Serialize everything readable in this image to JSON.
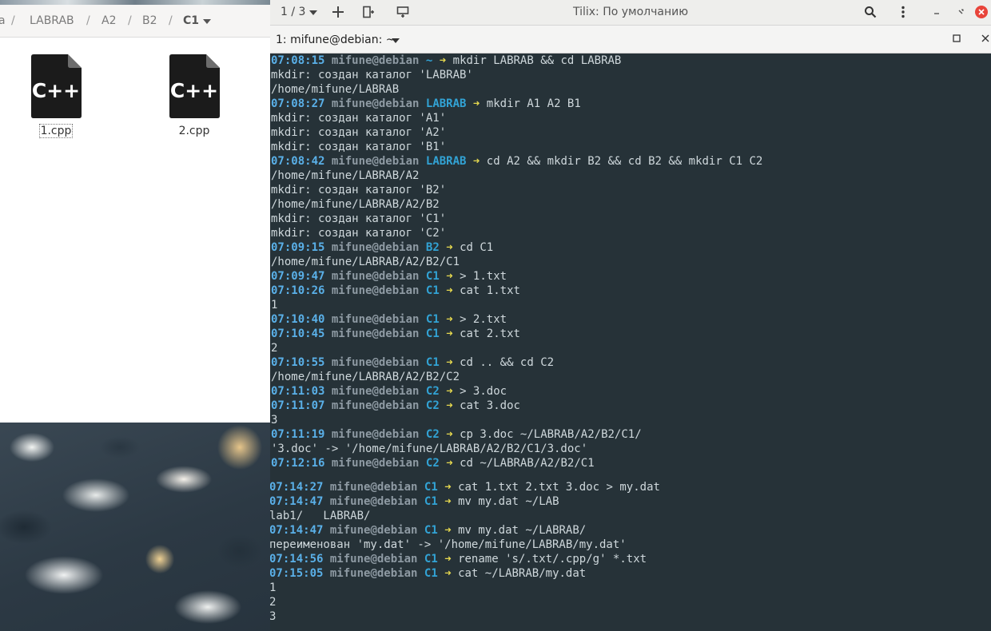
{
  "file_manager": {
    "path": [
      {
        "label": "a"
      },
      {
        "label": "LABRAB"
      },
      {
        "label": "A2"
      },
      {
        "label": "B2"
      },
      {
        "label": "C1",
        "current": true
      }
    ],
    "separator": "/",
    "files": [
      {
        "name": "1.cpp",
        "icon": "cpp-file-icon",
        "focused": true
      },
      {
        "name": "2.cpp",
        "icon": "cpp-file-icon"
      }
    ],
    "icon_text": "C++"
  },
  "terminal": {
    "session_label": "1 / 3",
    "window_title": "Tilix: По умолчанию",
    "tab_title": "1: mifune@debian: ~",
    "colors": {
      "background": "#263238",
      "time": "#5ab0e8",
      "user": "#8e9aa3",
      "dir": "#32a3d5",
      "arrow": "#e6d94f",
      "text": "#cfd8dc"
    },
    "lines": [
      {
        "type": "prompt",
        "time": "07:08:15",
        "user": "mifune@debian",
        "dir": "~",
        "arrow": "➜",
        "cmd": "mkdir LABRAB && cd LABRAB"
      },
      {
        "type": "out",
        "text": "mkdir: создан каталог 'LABRAB'"
      },
      {
        "type": "out",
        "text": "/home/mifune/LABRAB"
      },
      {
        "type": "prompt",
        "time": "07:08:27",
        "user": "mifune@debian",
        "dir": "LABRAB",
        "arrow": "➜",
        "cmd": "mkdir A1 A2 B1"
      },
      {
        "type": "out",
        "text": "mkdir: создан каталог 'A1'"
      },
      {
        "type": "out",
        "text": "mkdir: создан каталог 'A2'"
      },
      {
        "type": "out",
        "text": "mkdir: создан каталог 'B1'"
      },
      {
        "type": "prompt",
        "time": "07:08:42",
        "user": "mifune@debian",
        "dir": "LABRAB",
        "arrow": "➜",
        "cmd": "cd A2 && mkdir B2 && cd B2 && mkdir C1 C2"
      },
      {
        "type": "out",
        "text": "/home/mifune/LABRAB/A2"
      },
      {
        "type": "out",
        "text": "mkdir: создан каталог 'B2'"
      },
      {
        "type": "out",
        "text": "/home/mifune/LABRAB/A2/B2"
      },
      {
        "type": "out",
        "text": "mkdir: создан каталог 'C1'"
      },
      {
        "type": "out",
        "text": "mkdir: создан каталог 'C2'"
      },
      {
        "type": "prompt",
        "time": "07:09:15",
        "user": "mifune@debian",
        "dir": "B2",
        "arrow": "➜",
        "cmd": "cd C1"
      },
      {
        "type": "out",
        "text": "/home/mifune/LABRAB/A2/B2/C1"
      },
      {
        "type": "prompt",
        "time": "07:09:47",
        "user": "mifune@debian",
        "dir": "C1",
        "arrow": "➜",
        "cmd": "> 1.txt"
      },
      {
        "type": "prompt",
        "time": "07:10:26",
        "user": "mifune@debian",
        "dir": "C1",
        "arrow": "➜",
        "cmd": "cat 1.txt"
      },
      {
        "type": "out",
        "text": "1"
      },
      {
        "type": "prompt",
        "time": "07:10:40",
        "user": "mifune@debian",
        "dir": "C1",
        "arrow": "➜",
        "cmd": "> 2.txt"
      },
      {
        "type": "prompt",
        "time": "07:10:45",
        "user": "mifune@debian",
        "dir": "C1",
        "arrow": "➜",
        "cmd": "cat 2.txt"
      },
      {
        "type": "out",
        "text": "2"
      },
      {
        "type": "prompt",
        "time": "07:10:55",
        "user": "mifune@debian",
        "dir": "C1",
        "arrow": "➜",
        "cmd": "cd .. && cd C2"
      },
      {
        "type": "out",
        "text": "/home/mifune/LABRAB/A2/B2/C2"
      },
      {
        "type": "prompt",
        "time": "07:11:03",
        "user": "mifune@debian",
        "dir": "C2",
        "arrow": "➜",
        "cmd": "> 3.doc"
      },
      {
        "type": "prompt",
        "time": "07:11:07",
        "user": "mifune@debian",
        "dir": "C2",
        "arrow": "➜",
        "cmd": "cat 3.doc"
      },
      {
        "type": "out",
        "text": "3"
      },
      {
        "type": "prompt",
        "time": "07:11:19",
        "user": "mifune@debian",
        "dir": "C2",
        "arrow": "➜",
        "cmd": "cp 3.doc ~/LABRAB/A2/B2/C1/"
      },
      {
        "type": "out",
        "text": "'3.doc' -> '/home/mifune/LABRAB/A2/B2/C1/3.doc'"
      },
      {
        "type": "prompt",
        "time": "07:12:16",
        "user": "mifune@debian",
        "dir": "C2",
        "arrow": "➜",
        "cmd": "cd ~/LABRAB/A2/B2/C1"
      },
      {
        "type": "prompt",
        "time": "07:14:27",
        "user": "mifune@debian",
        "dir": "C1",
        "arrow": "➜",
        "cmd": "cat 1.txt 2.txt 3.doc > my.dat"
      },
      {
        "type": "prompt",
        "time": "07:14:47",
        "user": "mifune@debian",
        "dir": "C1",
        "arrow": "➜",
        "cmd": "mv my.dat ~/LAB"
      },
      {
        "type": "out",
        "text": "lab1/   LABRAB/"
      },
      {
        "type": "prompt",
        "time": "07:14:47",
        "user": "mifune@debian",
        "dir": "C1",
        "arrow": "➜",
        "cmd": "mv my.dat ~/LABRAB/"
      },
      {
        "type": "out",
        "text": "переименован 'my.dat' -> '/home/mifune/LABRAB/my.dat'"
      },
      {
        "type": "prompt",
        "time": "07:14:56",
        "user": "mifune@debian",
        "dir": "C1",
        "arrow": "➜",
        "cmd": "rename 's/.txt/.cpp/g' *.txt"
      },
      {
        "type": "prompt",
        "time": "07:15:05",
        "user": "mifune@debian",
        "dir": "C1",
        "arrow": "➜",
        "cmd": "cat ~/LABRAB/my.dat"
      },
      {
        "type": "out",
        "text": "1"
      },
      {
        "type": "out",
        "text": "2"
      },
      {
        "type": "out",
        "text": "3"
      }
    ]
  }
}
